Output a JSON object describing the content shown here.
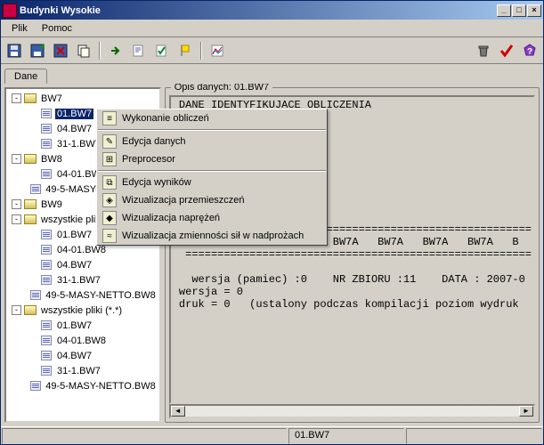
{
  "window": {
    "title": "Budynki Wysokie"
  },
  "menu": {
    "items": [
      "Plik",
      "Pomoc"
    ]
  },
  "toolbar": {
    "left": [
      "save-icon",
      "append-icon",
      "delete-icon",
      "copy-icon",
      "forward-icon",
      "edit-icon",
      "check-icon",
      "flag-icon",
      "chart-icon"
    ],
    "right": [
      "trash-icon",
      "red-check-icon",
      "help-icon"
    ]
  },
  "tabs": {
    "active": "Dane"
  },
  "tree": {
    "nodes": [
      {
        "level": 0,
        "expander": "-",
        "icon": "folder",
        "label": "BW7"
      },
      {
        "level": 1,
        "expander": "",
        "icon": "file",
        "label": "01.BW7",
        "selected": true
      },
      {
        "level": 1,
        "expander": "",
        "icon": "file",
        "label": "04.BW7"
      },
      {
        "level": 1,
        "expander": "",
        "icon": "file",
        "label": "31-1.BW7"
      },
      {
        "level": 0,
        "expander": "-",
        "icon": "folder",
        "label": "BW8"
      },
      {
        "level": 1,
        "expander": "",
        "icon": "file",
        "label": "04-01.BW8"
      },
      {
        "level": 1,
        "expander": "",
        "icon": "file",
        "label": "49-5-MASY-NETTO.BW8"
      },
      {
        "level": 0,
        "expander": "-",
        "icon": "folder",
        "label": "BW9"
      },
      {
        "level": 0,
        "expander": "-",
        "icon": "folder",
        "label": "wszystkie pliki (*.*)"
      },
      {
        "level": 1,
        "expander": "",
        "icon": "file",
        "label": "01.BW7"
      },
      {
        "level": 1,
        "expander": "",
        "icon": "file",
        "label": "04-01.BW8"
      },
      {
        "level": 1,
        "expander": "",
        "icon": "file",
        "label": "04.BW7"
      },
      {
        "level": 1,
        "expander": "",
        "icon": "file",
        "label": "31-1.BW7"
      },
      {
        "level": 1,
        "expander": "",
        "icon": "file",
        "label": "49-5-MASY-NETTO.BW8"
      },
      {
        "level": 0,
        "expander": "-",
        "icon": "folder",
        "label": "wszystkie pliki (*.*)"
      },
      {
        "level": 1,
        "expander": "",
        "icon": "file",
        "label": "01.BW7"
      },
      {
        "level": 1,
        "expander": "",
        "icon": "file",
        "label": "04-01.BW8"
      },
      {
        "level": 1,
        "expander": "",
        "icon": "file",
        "label": "04.BW7"
      },
      {
        "level": 1,
        "expander": "",
        "icon": "file",
        "label": "31-1.BW7"
      },
      {
        "level": 1,
        "expander": "",
        "icon": "file",
        "label": "49-5-MASY-NETTO.BW8"
      }
    ]
  },
  "opis": {
    "legend": "Opis danych: 01.BW7",
    "body": " DANE IDENTYFIKUJACE OBLICZENIA\n ITKB PP\n\n\nJ.GLUCK\n974),PP.29-38\n\n\n\n\n  ======================================================\n    BW7A   BW7A   BW7A   BW7A   BW7A   BW7A   BW7A   B\n  ======================================================\n\n   wersja (pamiec) :0    NR ZBIORU :11    DATA : 2007-0\n wersja = 0\n druk = 0   (ustalony podczas kompilacji poziom wydruk"
  },
  "context_menu": {
    "items": [
      {
        "icon": "calc-icon",
        "label": "Wykonanie obliczeń"
      },
      {
        "sep": true
      },
      {
        "icon": "edit-icon",
        "label": "Edycja danych"
      },
      {
        "icon": "prep-icon",
        "label": "Preprocesor"
      },
      {
        "sep": true
      },
      {
        "icon": "result-icon",
        "label": "Edycja wyników"
      },
      {
        "icon": "disp-icon",
        "label": "Wizualizacja przemieszczeń"
      },
      {
        "icon": "stress-icon",
        "label": "Wizualizacja naprężeń"
      },
      {
        "icon": "force-icon",
        "label": "Wizualizacja zmienności sił w nadprożach"
      }
    ]
  },
  "statusbar": {
    "file": "01.BW7"
  }
}
